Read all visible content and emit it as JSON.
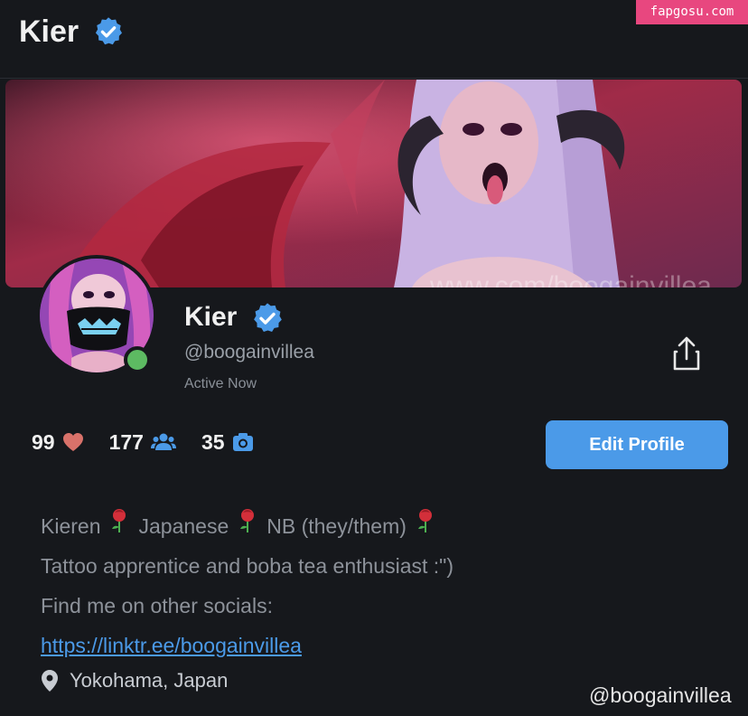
{
  "header": {
    "title": "Kier",
    "verified_icon": "verified-badge-icon"
  },
  "watermark_top": "fapgosu.com",
  "banner": {
    "overlay_text": "www.com/boogainvillea"
  },
  "profile": {
    "name": "Kier",
    "handle": "@boogainvillea",
    "status": "Active Now",
    "online": true,
    "online_color": "#5dba62"
  },
  "stats": [
    {
      "value": "99",
      "icon": "heart-icon"
    },
    {
      "value": "177",
      "icon": "users-icon"
    },
    {
      "value": "35",
      "icon": "camera-icon"
    }
  ],
  "actions": {
    "edit_profile": "Edit Profile",
    "share_icon": "share-icon"
  },
  "bio": {
    "line1_parts": [
      "Kieren",
      "Japanese",
      "NB (they/them)"
    ],
    "line2": "Tattoo apprentice and boba tea enthusiast :\")",
    "line3": "Find me on other socials:",
    "link": "https://linktr.ee/boogainvillea"
  },
  "location": "Yokohama, Japan",
  "watermark_bottom": "@boogainvillea",
  "colors": {
    "background": "#16181c",
    "accent": "#4b9ae8",
    "heart": "#d9726a",
    "icon_blue": "#4b9ae8",
    "watermark_pink": "#e8477f"
  }
}
